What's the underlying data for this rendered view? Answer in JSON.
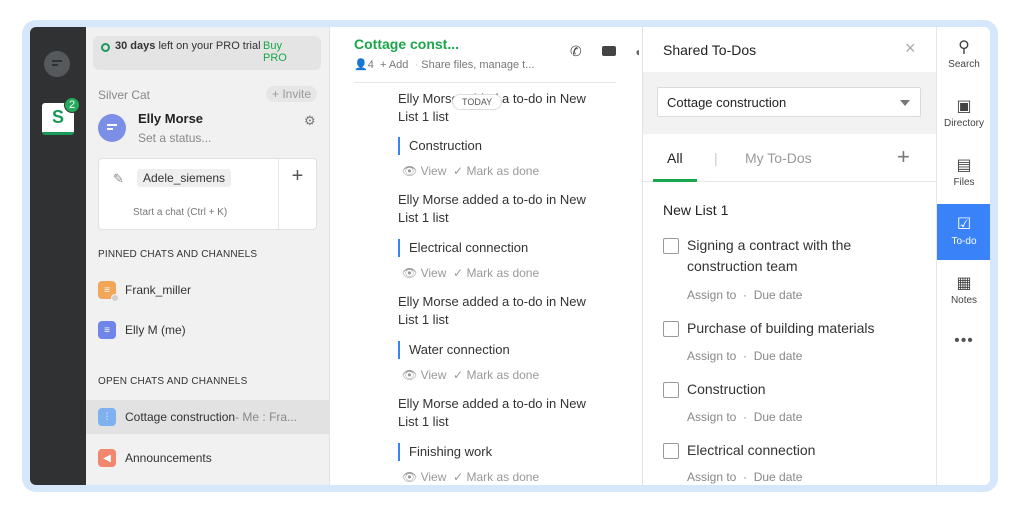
{
  "trial": {
    "days": "30 days",
    "text": "left on your PRO trial",
    "buy": "Buy PRO"
  },
  "rail": {
    "workspace_letter": "S",
    "badge": "2"
  },
  "sidebar": {
    "workspace_name": "Silver Cat",
    "invite": "+ Invite",
    "me_name": "Elly Morse",
    "me_status": "Set a status...",
    "compose_chip": "Adele_siemens",
    "compose_hint": "Start a chat (Ctrl + K)",
    "compose_plus": "+",
    "pinned_header": "PINNED CHATS AND CHANNELS",
    "pinned": [
      {
        "name": "Frank_miller"
      },
      {
        "name": "Elly M (me)"
      }
    ],
    "open_header": "OPEN CHATS AND CHANNELS",
    "open": [
      {
        "name": "Cottage construction",
        "preview": " - Me : Fra..."
      },
      {
        "name": "Announcements",
        "preview": ""
      }
    ]
  },
  "chat": {
    "title": "Cottage const...",
    "members": "4",
    "add": "+ Add",
    "subtitle": "Share files, manage t...",
    "today": "TODAY",
    "view": "View",
    "mark_done": "Mark as done",
    "messages": [
      {
        "text": "Elly Morse added a to-do in New List 1 list",
        "todo": "Construction"
      },
      {
        "text": "Elly Morse added a to-do in New List 1 list",
        "todo": "Electrical connection"
      },
      {
        "text": "Elly Morse added a to-do in New List 1 list",
        "todo": "Water connection"
      },
      {
        "text": "Elly Morse added a to-do in New List 1 list",
        "todo": "Finishing work"
      }
    ]
  },
  "panel": {
    "title": "Shared To-Dos",
    "close": "×",
    "selected_list": "Cottage construction",
    "tab_all": "All",
    "tab_sep": "|",
    "tab_mine": "My To-Dos",
    "tab_add": "+",
    "list_title": "New List 1",
    "assign": "Assign to",
    "dot": "·",
    "due": "Due date",
    "todos": [
      {
        "text": "Signing a contract with the construction team"
      },
      {
        "text": "Purchase of building materials"
      },
      {
        "text": "Construction"
      },
      {
        "text": "Electrical connection"
      }
    ]
  },
  "right_rail": {
    "items": [
      {
        "label": "Search",
        "icon": "search-icon"
      },
      {
        "label": "Directory",
        "icon": "directory-icon"
      },
      {
        "label": "Files",
        "icon": "files-icon"
      },
      {
        "label": "To-do",
        "icon": "todo-icon"
      },
      {
        "label": "Notes",
        "icon": "notes-icon"
      }
    ],
    "more": "•••"
  },
  "colors": {
    "accent_green": "#1aa64a",
    "accent_blue": "#3a82f7",
    "rail_dark": "#2f3133"
  }
}
